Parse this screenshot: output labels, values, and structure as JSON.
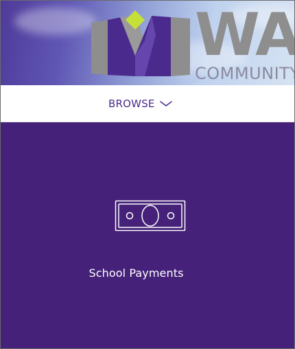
{
  "header": {
    "logo_icon": "community-logo-icon",
    "wordmark": "WA",
    "subword": "COMMUNITY",
    "colors": {
      "banner_start": "#4f3a99",
      "banner_end": "#d6e3f3",
      "logo_gray": "#8e8e8e",
      "logo_purple": "#4a2a8c",
      "logo_green": "#c6e03a"
    }
  },
  "nav": {
    "browse_label": "BROWSE",
    "browse_icon": "chevron-down-icon",
    "accent": "#4a2a8c"
  },
  "main": {
    "background": "#452179",
    "tiles": [
      {
        "label": "School Payments",
        "icon": "money-bill-icon"
      }
    ]
  }
}
